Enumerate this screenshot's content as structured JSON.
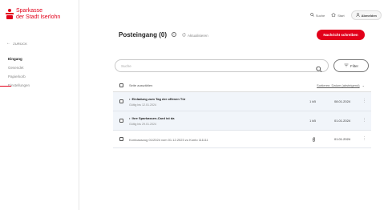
{
  "brand": {
    "logo_line1": "Sparkasse",
    "logo_line2": "der Stadt Iserlohn",
    "accent_color": "#e2001a"
  },
  "sidebar": {
    "back_label": "ZURÜCK",
    "items": [
      {
        "label": "Eingang",
        "active": true
      },
      {
        "label": "Gesendet",
        "active": false
      },
      {
        "label": "Papierkorb",
        "active": false
      },
      {
        "label": "Einstellungen",
        "active": false
      }
    ]
  },
  "topbar": {
    "search_label": "Suche",
    "search_icon": "search-icon",
    "start_label": "Start",
    "home_icon": "home-icon",
    "account_label": "Abmelden",
    "account_icon": "user-icon"
  },
  "header": {
    "title": "Posteingang (0)",
    "info_icon": "info-icon",
    "refresh_label": "Aktualisieren",
    "refresh_icon": "refresh-icon",
    "compose_label": "Nachricht schreiben"
  },
  "search": {
    "placeholder": "Suche",
    "value": ""
  },
  "filter": {
    "label": "Filter",
    "icon": "filter-icon"
  },
  "table": {
    "select_all_label": "Seite auswählen",
    "sort_label": "Sortieren: Datum (absteigend)",
    "rows": [
      {
        "subject": "Einladung zum Tag der offenen Tür",
        "valid": "Gültig bis 12.01.2024",
        "size": "1 kB",
        "date": "08.01.2024",
        "unread": true,
        "attachment": false
      },
      {
        "subject": "Ihre Sparkassen-Card ist da",
        "valid": "Gültig bis 29.01.2024",
        "size": "1 kB",
        "date": "01.01.2024",
        "unread": true,
        "attachment": false
      },
      {
        "subject": "Kontoauszug 01/2024 vom 01.12.2023 zu Konto 111111",
        "valid": "",
        "size": "",
        "date": "01.01.2024",
        "unread": false,
        "attachment": true
      }
    ]
  }
}
